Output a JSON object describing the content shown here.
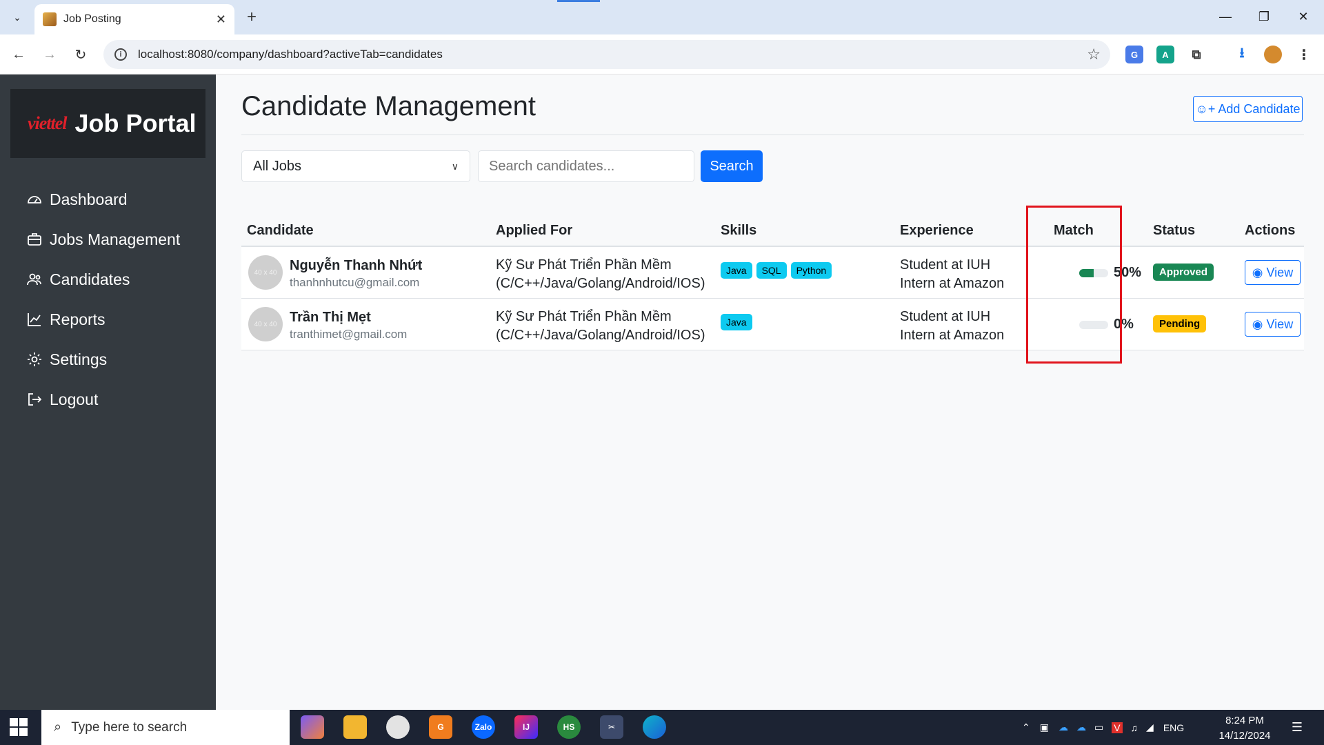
{
  "browser": {
    "tab_title": "Job Posting",
    "url": "localhost:8080/company/dashboard?activeTab=candidates"
  },
  "sidebar": {
    "brand_logo": "viettel",
    "brand_title": "Job Portal",
    "items": [
      {
        "label": "Dashboard",
        "icon": "dashboard-icon"
      },
      {
        "label": "Jobs Management",
        "icon": "briefcase-icon"
      },
      {
        "label": "Candidates",
        "icon": "people-icon"
      },
      {
        "label": "Reports",
        "icon": "chart-icon"
      },
      {
        "label": "Settings",
        "icon": "gear-icon"
      },
      {
        "label": "Logout",
        "icon": "logout-icon"
      }
    ]
  },
  "main": {
    "title": "Candidate Management",
    "add_button": "Add Candidate",
    "filter_value": "All Jobs",
    "search_placeholder": "Search candidates...",
    "search_button": "Search",
    "columns": [
      "Candidate",
      "Applied For",
      "Skills",
      "Experience",
      "Match",
      "Status",
      "Actions"
    ],
    "rows": [
      {
        "avatar": "40 x 40",
        "name": "Nguyễn Thanh Nhứt",
        "email": "thanhnhutcu@gmail.com",
        "applied_line1": "Kỹ Sư Phát Triển Phần Mềm",
        "applied_line2": "(C/C++/Java/Golang/Android/IOS)",
        "skills": [
          "Java",
          "SQL",
          "Python"
        ],
        "exp_line1": "Student at IUH",
        "exp_line2": "Intern at Amazon",
        "match_percent": 50,
        "match_label": "50%",
        "status": "Approved",
        "status_color": "#198754",
        "action": "View"
      },
      {
        "avatar": "40 x 40",
        "name": "Trần Thị Mẹt",
        "email": "tranthimet@gmail.com",
        "applied_line1": "Kỹ Sư Phát Triển Phần Mềm",
        "applied_line2": "(C/C++/Java/Golang/Android/IOS)",
        "skills": [
          "Java"
        ],
        "exp_line1": "Student at IUH",
        "exp_line2": "Intern at Amazon",
        "match_percent": 0,
        "match_label": "0%",
        "status": "Pending",
        "status_color": "#ffc107",
        "action": "View"
      }
    ]
  },
  "taskbar": {
    "search_placeholder": "Type here to search",
    "language": "ENG",
    "time": "8:24 PM",
    "date": "14/12/2024"
  },
  "colors": {
    "accent": "#0d6efd",
    "sidebar_bg": "#343a40",
    "highlight": "#e1141c"
  }
}
